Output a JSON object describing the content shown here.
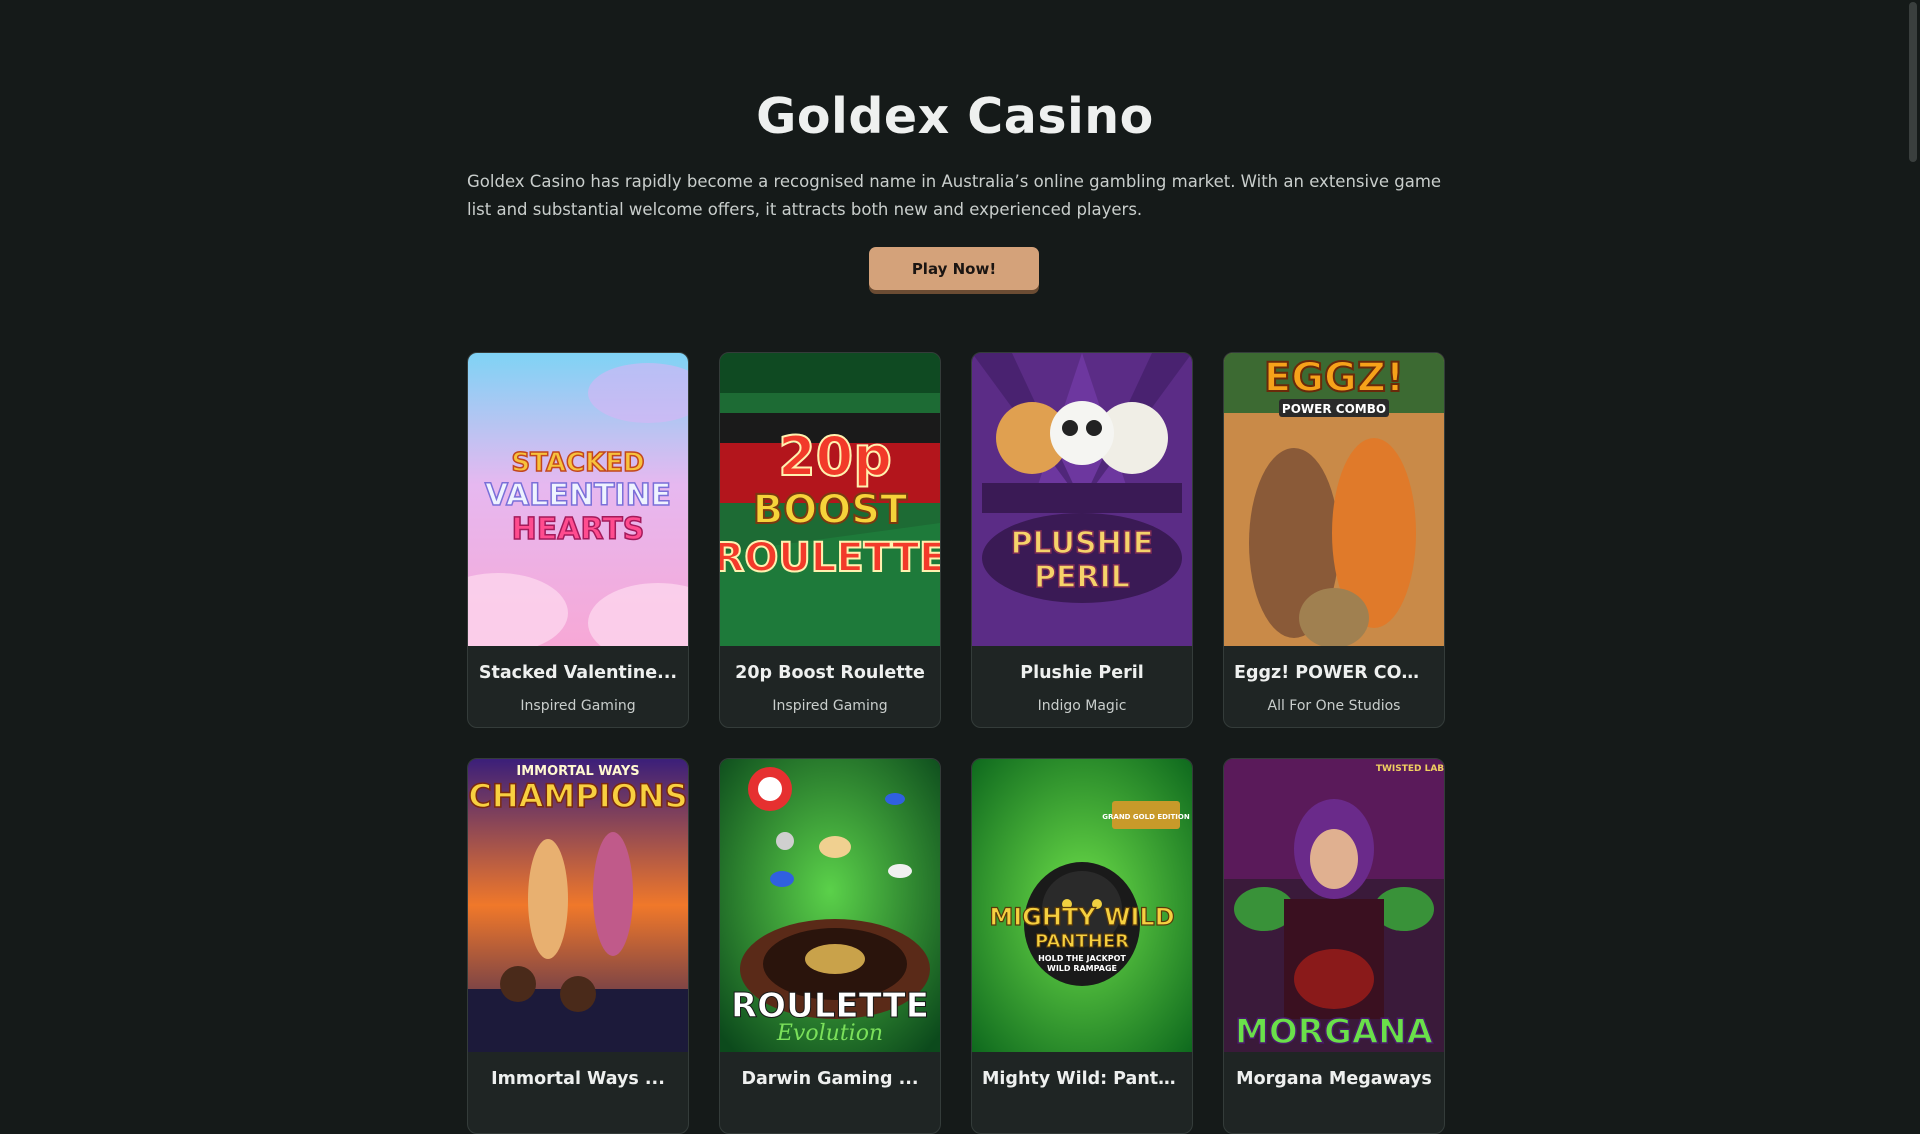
{
  "header": {
    "title": "Goldex Casino",
    "description": "Goldex Casino has rapidly become a recognised name in Australia’s online gambling market. With an extensive game list and substantial welcome offers, it attracts both new and experienced players.",
    "cta_label": "Play Now!"
  },
  "colors": {
    "background": "#151a19",
    "card": "#1f2524",
    "accent": "#d4a27a"
  },
  "games": [
    {
      "title": "Stacked Valentine...",
      "provider": "Inspired Gaming",
      "art_lines": [
        "STACKED",
        "VALENTINE",
        "HEARTS"
      ]
    },
    {
      "title": "20p Boost Roulette",
      "provider": "Inspired Gaming",
      "art_lines": [
        "20p",
        "BOOST",
        "ROULETTE"
      ]
    },
    {
      "title": "Plushie Peril",
      "provider": "Indigo Magic",
      "art_lines": [
        "PLUSHIE",
        "PERIL"
      ]
    },
    {
      "title": "Eggz! POWER COMBO",
      "provider": "All For One Studios",
      "art_lines": [
        "EGGZ!",
        "POWER COMBO"
      ]
    },
    {
      "title": "Immortal Ways ...",
      "provider": "",
      "art_lines": [
        "IMMORTAL WAYS",
        "CHAMPIONS"
      ]
    },
    {
      "title": "Darwin Gaming ...",
      "provider": "",
      "art_lines": [
        "ROULETTE",
        "Evolution"
      ]
    },
    {
      "title": "Mighty Wild: Panther ...",
      "provider": "",
      "art_lines": [
        "GRAND GOLD EDITION",
        "MIGHTY WILD",
        "PANTHER",
        "HOLD THE JACKPOT",
        "WILD RAMPAGE"
      ]
    },
    {
      "title": "Morgana Megaways",
      "provider": "",
      "art_lines": [
        "TWISTED LAB",
        "MORGANA"
      ]
    }
  ]
}
